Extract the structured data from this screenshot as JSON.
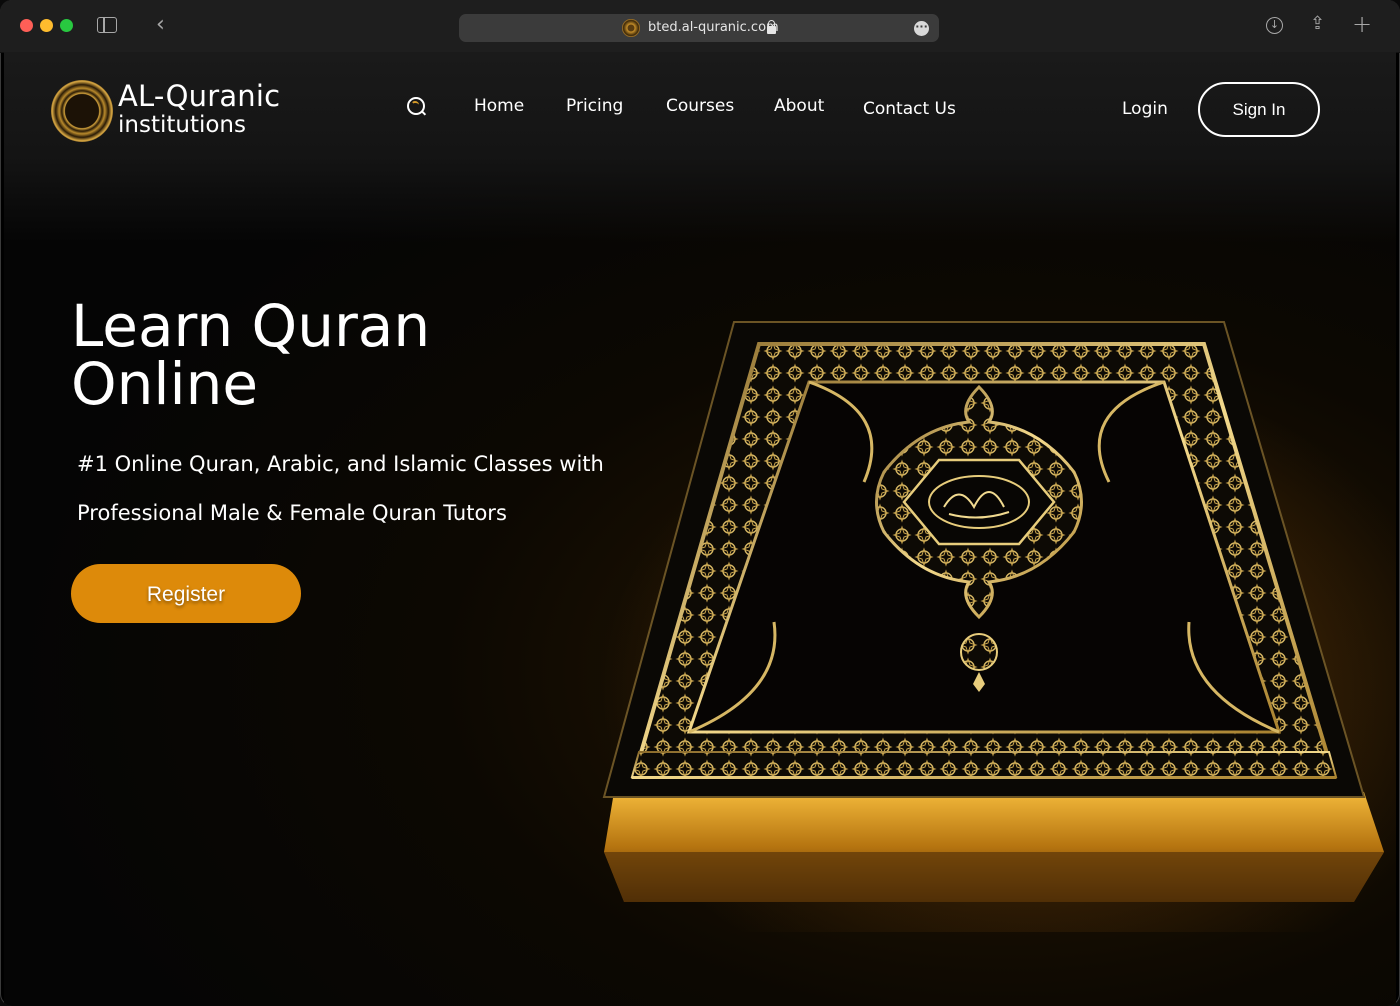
{
  "browser": {
    "url": "bted.al-quranic.com"
  },
  "header": {
    "logo_title": "AL-Quranic",
    "logo_subtitle": "institutions",
    "nav": {
      "home": "Home",
      "pricing": "Pricing",
      "courses": "Courses",
      "about": "About",
      "contact": "Contact Us"
    },
    "login_label": "Login",
    "signin_label": "Sign In"
  },
  "hero": {
    "title_line1": "Learn Quran",
    "title_line2": "Online",
    "subtitle_line1": "#1 Online Quran, Arabic, and Islamic Classes with",
    "subtitle_line2": "Professional Male & Female Quran Tutors",
    "register_label": "Register"
  },
  "colors": {
    "accent": "#dd8a0a",
    "gold": "#d9a843",
    "background": "#050505"
  }
}
